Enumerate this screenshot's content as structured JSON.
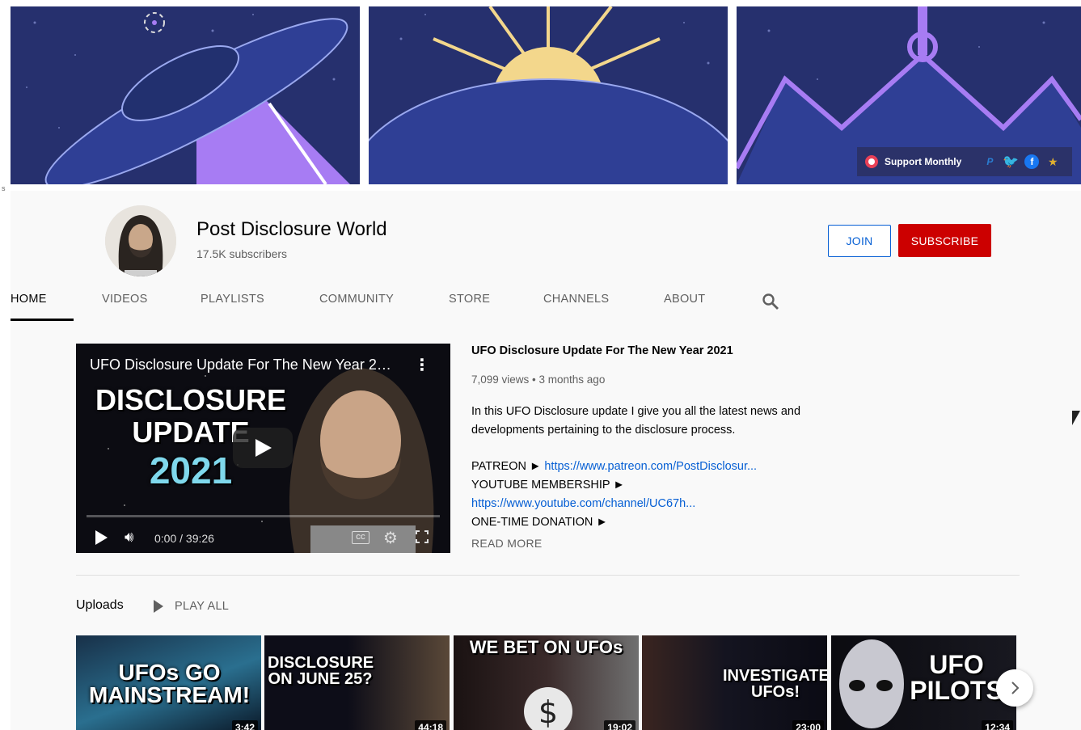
{
  "banner": {
    "support_label": "Support Monthly",
    "links": [
      "paypal-icon",
      "twitter-icon",
      "facebook-icon",
      "misc-icon"
    ]
  },
  "side_mark": "s",
  "channel": {
    "name": "Post Disclosure World",
    "subscribers": "17.5K subscribers",
    "join_label": "JOIN",
    "subscribe_label": "SUBSCRIBE"
  },
  "tabs": [
    {
      "label": "HOME",
      "active": true
    },
    {
      "label": "VIDEOS"
    },
    {
      "label": "PLAYLISTS"
    },
    {
      "label": "COMMUNITY"
    },
    {
      "label": "STORE"
    },
    {
      "label": "CHANNELS"
    },
    {
      "label": "ABOUT"
    }
  ],
  "featured": {
    "player_title": "UFO Disclosure Update For The New Year 2021",
    "thumb_line1": "DISCLOSURE",
    "thumb_line2": "UPDATE",
    "thumb_line3": "2021",
    "time": "0:00 / 39:26",
    "cc": "CC",
    "title": "UFO Disclosure Update For The New Year 2021",
    "meta": "7,099 views • 3 months ago",
    "desc_intro": "In this UFO Disclosure update I give you all the latest news and developments pertaining to the disclosure process.",
    "patreon_label": "PATREON ►",
    "patreon_link": "https://www.patreon.com/PostDisclosur...",
    "membership_label": "YOUTUBE MEMBERSHIP ►",
    "membership_link": "https://www.youtube.com/channel/UC67h...",
    "donation_label": "ONE-TIME DONATION ►",
    "read_more": "READ MORE"
  },
  "uploads": {
    "label": "Uploads",
    "play_all": "PLAY ALL",
    "videos": [
      {
        "thumb_text": "UFOs GO MAINSTREAM!",
        "duration": "3:42"
      },
      {
        "thumb_text": "DISCLOSURE ON JUNE 25?",
        "duration": "44:18"
      },
      {
        "thumb_text": "WE BET ON UFOs",
        "duration": "19:02"
      },
      {
        "thumb_text": "INVESTIGATE UFOs!",
        "duration": "23:00"
      },
      {
        "thumb_text": "UFO PILOTS",
        "duration": "12:34"
      }
    ]
  },
  "colors": {
    "accent_blue": "#065fd4",
    "subscribe_red": "#cc0000",
    "banner_navy": "#1e2a6b",
    "banner_purple": "#a77cf3"
  }
}
